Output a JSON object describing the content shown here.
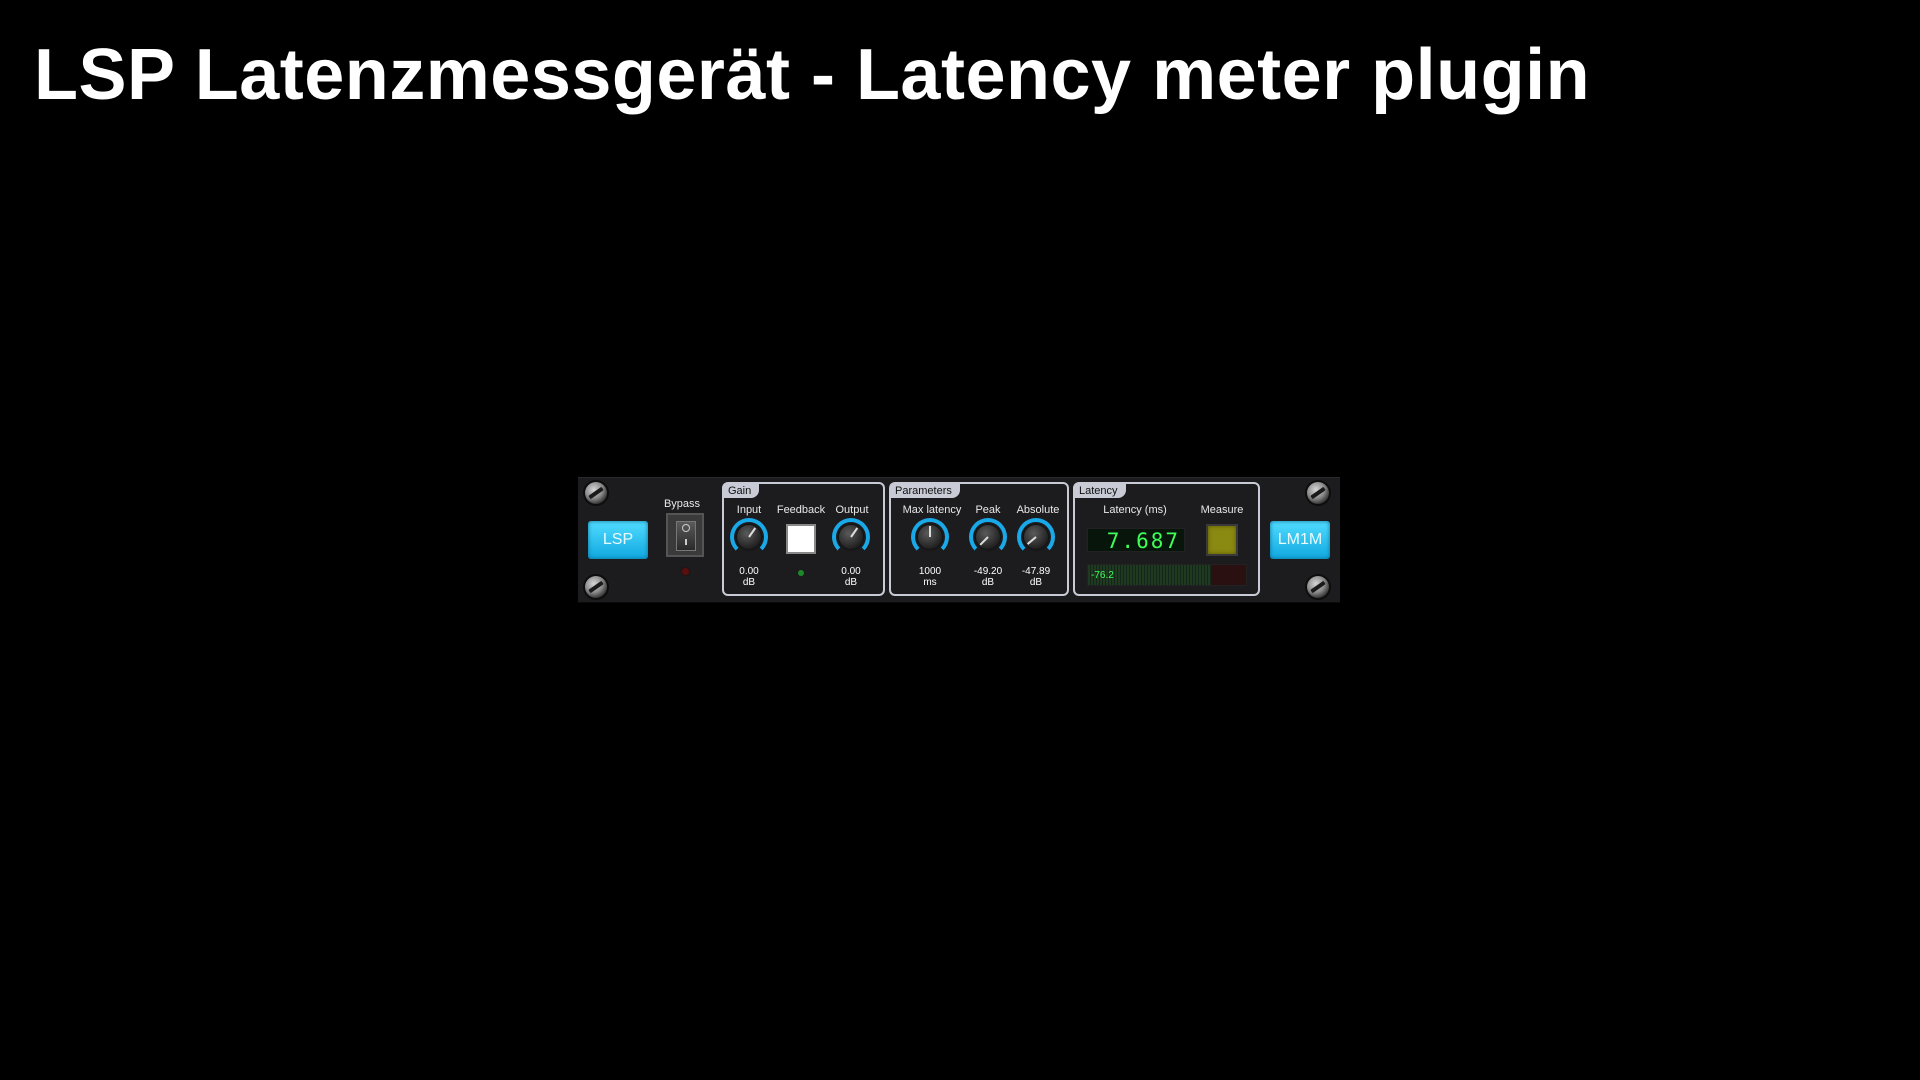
{
  "page": {
    "title": "LSP Latenzmessgerät - Latency meter plugin"
  },
  "plugin": {
    "logo_left": "LSP",
    "logo_right": "LM1M",
    "bypass": {
      "label": "Bypass",
      "state": "off"
    },
    "gain": {
      "label": "Gain",
      "input": {
        "label": "Input",
        "value": "0.00",
        "unit": "dB"
      },
      "feedback": {
        "label": "Feedback",
        "state": "on"
      },
      "output": {
        "label": "Output",
        "value": "0.00",
        "unit": "dB"
      }
    },
    "parameters": {
      "label": "Parameters",
      "max_latency": {
        "label": "Max latency",
        "value": "1000",
        "unit": "ms"
      },
      "peak": {
        "label": "Peak",
        "value": "-49.20",
        "unit": "dB"
      },
      "absolute": {
        "label": "Absolute",
        "value": "-47.89",
        "unit": "dB"
      }
    },
    "latency": {
      "label": "Latency",
      "display_label": "Latency (ms)",
      "value": "7.687",
      "measure_label": "Measure",
      "meter_value": "-76.2"
    }
  },
  "colors": {
    "accent": "#19a9e8",
    "display_green": "#3eff5a",
    "measure_button": "#8a8a12"
  }
}
